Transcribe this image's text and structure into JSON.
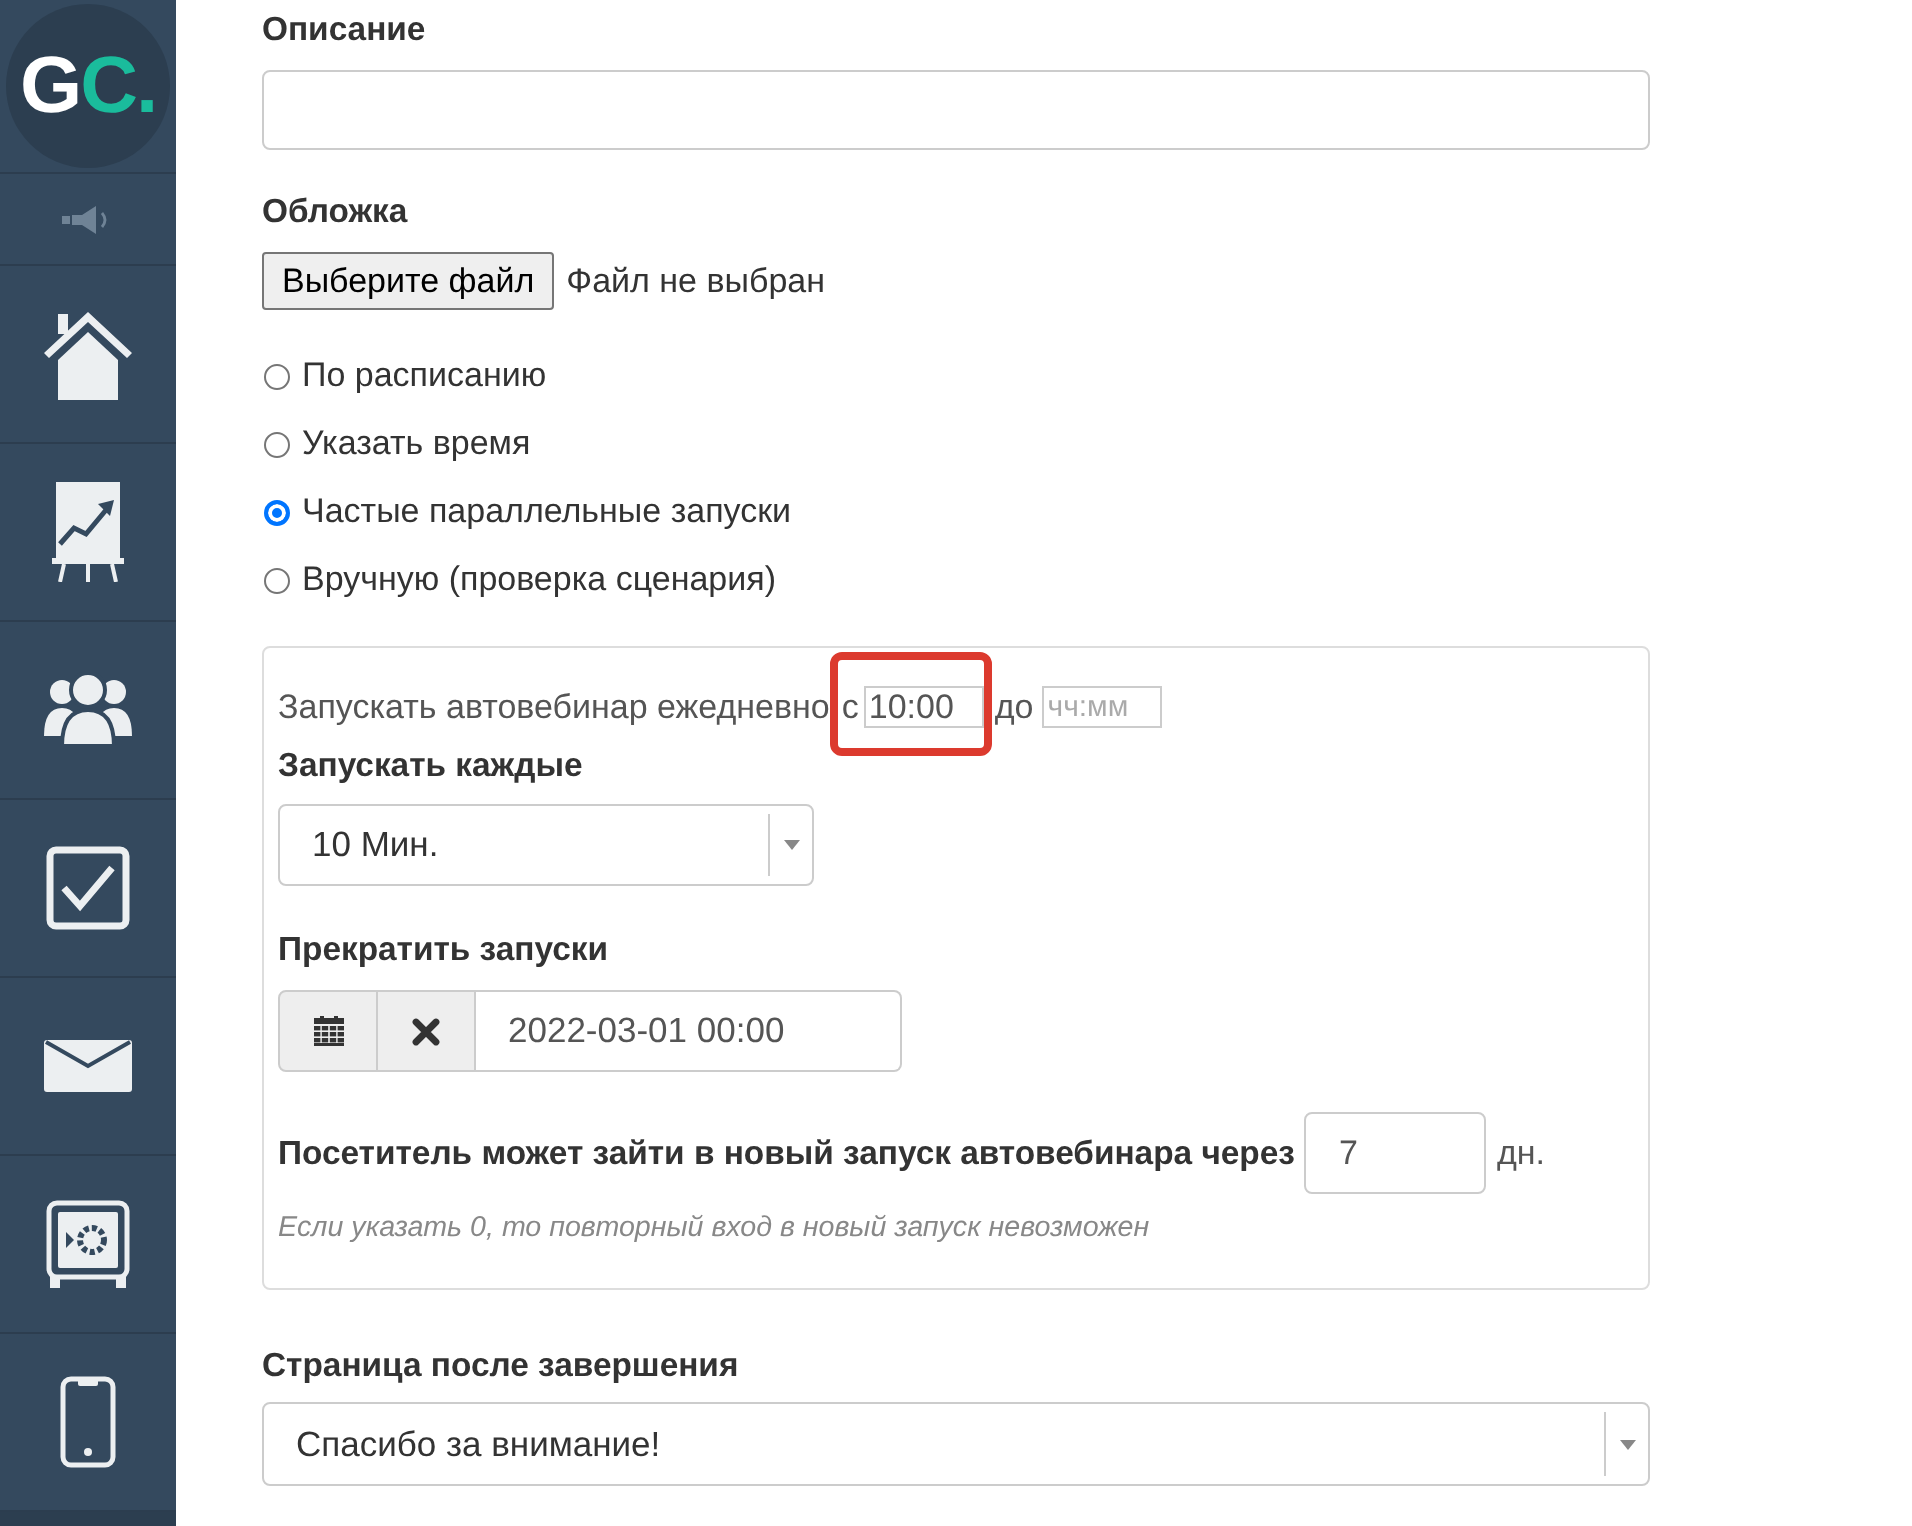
{
  "sidebar": {
    "logo": "GC."
  },
  "description": {
    "label": "Описание"
  },
  "cover": {
    "label": "Обложка",
    "button": "Выберите файл",
    "status": "Файл не выбран"
  },
  "launch_modes": [
    {
      "label": "По расписанию",
      "selected": false
    },
    {
      "label": "Указать время",
      "selected": false
    },
    {
      "label": "Частые параллельные запуски",
      "selected": true
    },
    {
      "label": "Вручную (проверка сценария)",
      "selected": false
    }
  ],
  "frequent_launches": {
    "daily_text": "Запускать автовебинар ежедневно",
    "from_label": "с",
    "start_time": {
      "value": "10:00",
      "highlighted": true
    },
    "to_label": "до",
    "end_time": {
      "placeholder": "чч:мм"
    },
    "interval": {
      "label": "Запускать каждые",
      "value": "10 Мин."
    },
    "stop": {
      "label": "Прекратить запуски",
      "value": "2022-03-01 00:00"
    },
    "reentry": {
      "label": "Посетитель может зайти в новый запуск автовебинара через",
      "value": "7",
      "unit": "дн.",
      "hint": "Если указать 0, то повторный вход в новый запуск невозможен"
    }
  },
  "finish_page": {
    "label": "Страница после завершения",
    "value": "Спасибо за внимание!"
  }
}
